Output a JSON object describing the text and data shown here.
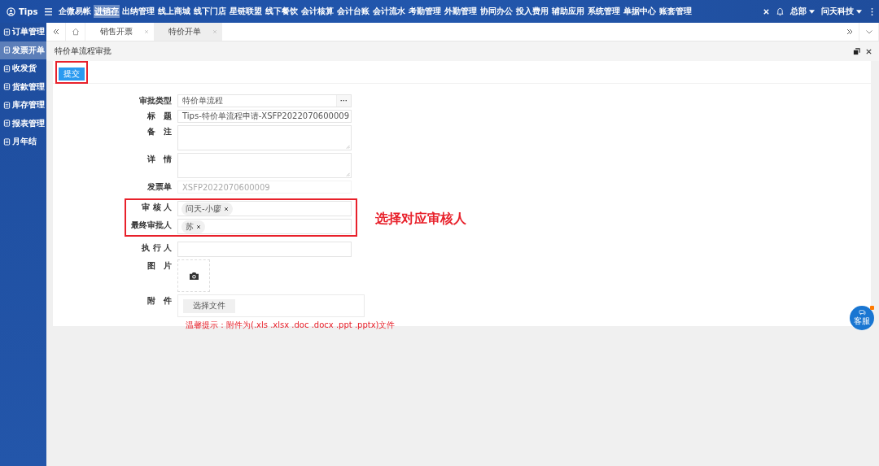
{
  "topbar": {
    "brand": "Tips",
    "menu": [
      {
        "label": "企微易帐",
        "selected": false
      },
      {
        "label": "进销存",
        "selected": true
      },
      {
        "label": "出纳管理",
        "selected": false
      },
      {
        "label": "线上商城",
        "selected": false
      },
      {
        "label": "线下门店",
        "selected": false
      },
      {
        "label": "星链联盟",
        "selected": false
      },
      {
        "label": "线下餐饮",
        "selected": false
      },
      {
        "label": "会计核算",
        "selected": false
      },
      {
        "label": "会计台账",
        "selected": false
      },
      {
        "label": "会计流水",
        "selected": false
      },
      {
        "label": "考勤管理",
        "selected": false
      },
      {
        "label": "外勤管理",
        "selected": false
      },
      {
        "label": "协同办公",
        "selected": false
      },
      {
        "label": "投入费用",
        "selected": false
      },
      {
        "label": "辅助应用",
        "selected": false
      },
      {
        "label": "系统管理",
        "selected": false
      },
      {
        "label": "单据中心",
        "selected": false
      },
      {
        "label": "账套管理",
        "selected": false
      }
    ],
    "org": "总部",
    "company": "问天科技"
  },
  "sidebar": {
    "items": [
      {
        "label": "订单管理",
        "selected": false
      },
      {
        "label": "发票开单",
        "selected": true
      },
      {
        "label": "收发货",
        "selected": false
      },
      {
        "label": "货款管理",
        "selected": false
      },
      {
        "label": "库存管理",
        "selected": false
      },
      {
        "label": "报表管理",
        "selected": false
      },
      {
        "label": "月年结",
        "selected": false
      }
    ]
  },
  "tabs": [
    {
      "label": "销售开票",
      "selected": false
    },
    {
      "label": "特价开单",
      "selected": true
    }
  ],
  "page_title": "特价单流程审批",
  "submit": {
    "label": "提交",
    "highlighted": true
  },
  "fields": [
    {
      "kind": "select",
      "label": "审批类型",
      "value": "特价单流程",
      "button": "···",
      "highlighted": false
    },
    {
      "kind": "text",
      "label": "标　题",
      "value": "Tips-特价单流程申请-XSFP2022070600009",
      "highlighted": false
    },
    {
      "kind": "textarea",
      "label": "备　注",
      "highlighted": false
    },
    {
      "kind": "textarea",
      "label": "详　情",
      "highlighted": false
    },
    {
      "kind": "readonly",
      "label": "发票单",
      "value": "XSFP2022070600009",
      "highlighted": false
    },
    {
      "kind": "tags",
      "label": "审 核 人",
      "tags": [
        "问天-小廖"
      ],
      "highlighted": true
    },
    {
      "kind": "tags",
      "label": "最终审批人",
      "tags": [
        "苏"
      ],
      "highlighted": true
    },
    {
      "kind": "tags",
      "label": "执 行 人",
      "highlighted": false
    },
    {
      "kind": "image",
      "label": "图　片",
      "highlighted": false
    },
    {
      "kind": "file",
      "label": "附　件",
      "button": "选择文件",
      "hint": "温馨提示：附件为(.xls .xlsx .doc .docx .ppt .pptx)文件",
      "highlighted": false
    }
  ],
  "annotation": "选择对应审核人",
  "chat": {
    "label": "客服",
    "unread": true
  }
}
